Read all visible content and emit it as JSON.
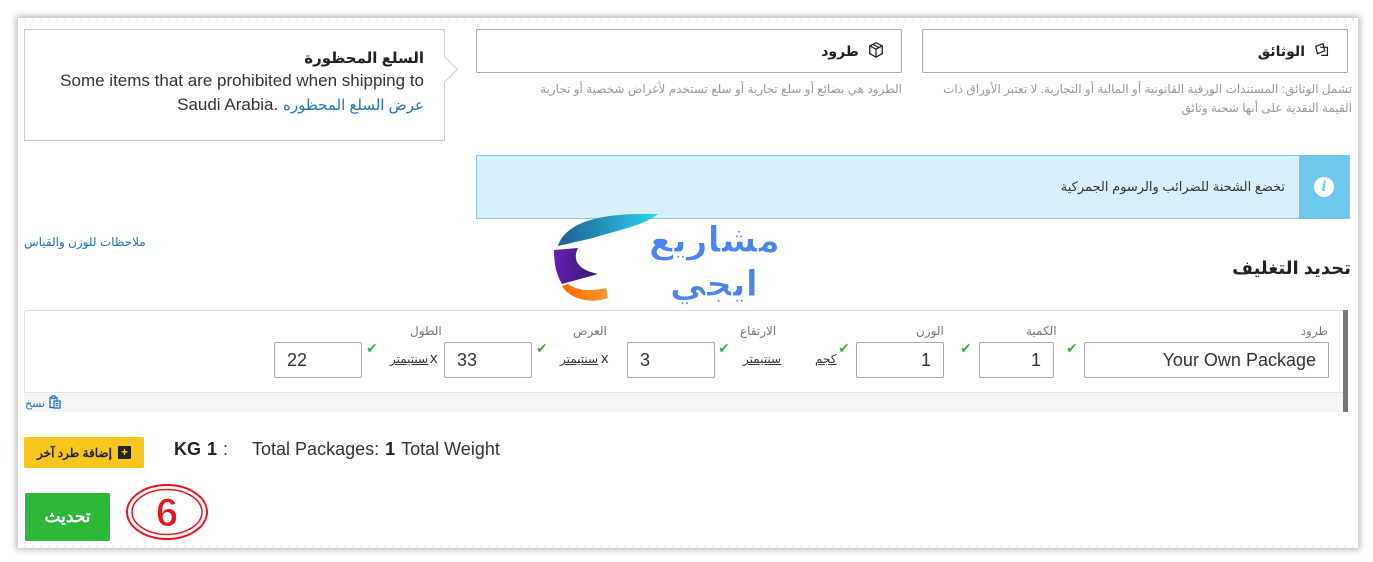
{
  "prohibited": {
    "title": "السلع المحظورة",
    "text": "Some items that are prohibited when shipping to Saudi Arabia.",
    "link": "عرض السلع المحظوره"
  },
  "types": [
    {
      "icon": "documents-icon",
      "label": "الوثائق",
      "description": "تشمل الوثائق: المستندات الورقية القانونية أو المالية أو التجارية. لا تعتبر الأوراق ذات القيمة النقدية على أنها شحنة وثائق"
    },
    {
      "icon": "package-icon",
      "label": "طرود",
      "description": "الطرود هي بضائع أو سلع تجارية أو سلع تستخدم لأغراض شخصية أو تجارية"
    }
  ],
  "alert": {
    "icon": "info-icon",
    "text": "تخضع الشحنة للضرائب والرسوم الجمركية"
  },
  "notes_link": "ملاحظات للوزن والقياس",
  "section_title": "تحديد التغليف",
  "watermark": {
    "line1": "مشاريع",
    "line2": "ايجي"
  },
  "package_row": {
    "package": {
      "label": "طرود",
      "value": "Your Own Package"
    },
    "quantity": {
      "label": "الكمية",
      "value": "1"
    },
    "weight": {
      "label": "الوزن",
      "value": "1",
      "unit": "كجم"
    },
    "height": {
      "label": "الارتفاع",
      "value": "3",
      "unit": "سنتيمتر"
    },
    "width": {
      "label": "العرض",
      "value": "33",
      "unit": "سنتيمتر"
    },
    "length": {
      "label": "الطول",
      "value": "22",
      "unit": "سنتيمتر"
    },
    "times_symbol": "x",
    "copy_label": "نسخ"
  },
  "add_package_button": "إضافة طرد آخر",
  "totals": {
    "packages_label": "Total Packages:",
    "packages_value": "1",
    "weight_label": "Total Weight",
    "separator": ":",
    "weight_value": "1",
    "weight_unit": "KG"
  },
  "update_button": "تحديث",
  "step_marker": "6",
  "colors": {
    "primary_green": "#2db83a",
    "accent_yellow": "#f9c51f",
    "info_blue": "#6ec8ec",
    "link_blue": "#1e73be",
    "marker_red": "#e8141c"
  }
}
